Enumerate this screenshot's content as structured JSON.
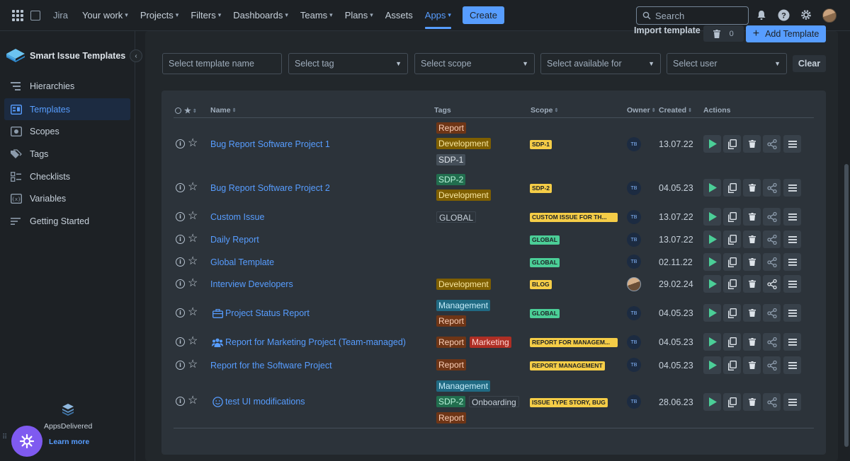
{
  "topnav": {
    "brand": "Jira",
    "items": [
      {
        "label": "Your work",
        "chevron": true
      },
      {
        "label": "Projects",
        "chevron": true
      },
      {
        "label": "Filters",
        "chevron": true
      },
      {
        "label": "Dashboards",
        "chevron": true
      },
      {
        "label": "Teams",
        "chevron": true
      },
      {
        "label": "Plans",
        "chevron": true
      },
      {
        "label": "Assets",
        "chevron": false
      },
      {
        "label": "Apps",
        "chevron": true
      }
    ],
    "create_label": "Create",
    "search_placeholder": "Search"
  },
  "sidebar": {
    "title": "Smart Issue Templates",
    "items": [
      {
        "label": "Hierarchies",
        "icon": "hierarchy-icon"
      },
      {
        "label": "Templates",
        "icon": "templates-icon"
      },
      {
        "label": "Scopes",
        "icon": "scopes-icon"
      },
      {
        "label": "Tags",
        "icon": "tag-icon"
      },
      {
        "label": "Checklists",
        "icon": "checklist-icon"
      },
      {
        "label": "Variables",
        "icon": "variable-icon"
      },
      {
        "label": "Getting Started",
        "icon": "getting-started-icon"
      }
    ],
    "vendor_name": "AppsDelivered",
    "learn_more": "Learn more"
  },
  "toolbar": {
    "import_label": "Import template",
    "trash_count": "0",
    "add_label": "Add Template"
  },
  "filters": {
    "template_name_placeholder": "Select template name",
    "tag": "Select tag",
    "scope": "Select scope",
    "available_for": "Select available for",
    "user": "Select user",
    "clear": "Clear"
  },
  "table": {
    "headers": {
      "name": "Name",
      "tags": "Tags",
      "scope": "Scope",
      "owner": "Owner",
      "created": "Created",
      "actions": "Actions"
    },
    "rows": [
      {
        "name": "Bug Report Software Project 1",
        "tags": [
          "Report",
          "Development",
          "SDP-1"
        ],
        "scope": "SDP-1",
        "owner": "TB",
        "created": "13.07.22"
      },
      {
        "name": "Bug Report Software Project 2",
        "tags": [
          "SDP-2",
          "Development"
        ],
        "scope": "SDP-2",
        "owner": "TB",
        "created": "04.05.23"
      },
      {
        "name": "Custom Issue",
        "tags": [
          "GLOBAL"
        ],
        "scope": "CUSTOM ISSUE FOR TH...",
        "owner": "TB",
        "created": "13.07.22"
      },
      {
        "name": "Daily Report",
        "tags": [],
        "scope": "GLOBAL",
        "owner": "TB",
        "created": "13.07.22"
      },
      {
        "name": "Global Template",
        "tags": [],
        "scope": "GLOBAL",
        "owner": "TB",
        "created": "02.11.22"
      },
      {
        "name": "Interview Developers",
        "tags": [
          "Development"
        ],
        "scope": "BLOG",
        "owner": "",
        "created": "29.02.24"
      },
      {
        "name": "Project Status Report",
        "tags": [
          "Management",
          "Report"
        ],
        "scope": "GLOBAL",
        "owner": "TB",
        "created": "04.05.23"
      },
      {
        "name": "Report for Marketing Project (Team-managed)",
        "tags": [
          "Report",
          "Marketing"
        ],
        "scope": "REPORT FOR MANAGEM...",
        "owner": "TB",
        "created": "04.05.23"
      },
      {
        "name": "Report for the Software Project",
        "tags": [
          "Report"
        ],
        "scope": "REPORT MANAGEMENT",
        "owner": "TB",
        "created": "04.05.23"
      },
      {
        "name": "test UI modifications",
        "tags": [
          "Management",
          "SDP-2",
          "Onboarding",
          "Report"
        ],
        "scope": "ISSUE TYPE STORY, BUG",
        "owner": "TB",
        "created": "28.06.23"
      }
    ]
  },
  "colors": {
    "accent": "#579dff",
    "background": "#1d2125",
    "panel": "#2c333a",
    "scope_yellow": "#f5cd47",
    "scope_green": "#4bce97"
  }
}
